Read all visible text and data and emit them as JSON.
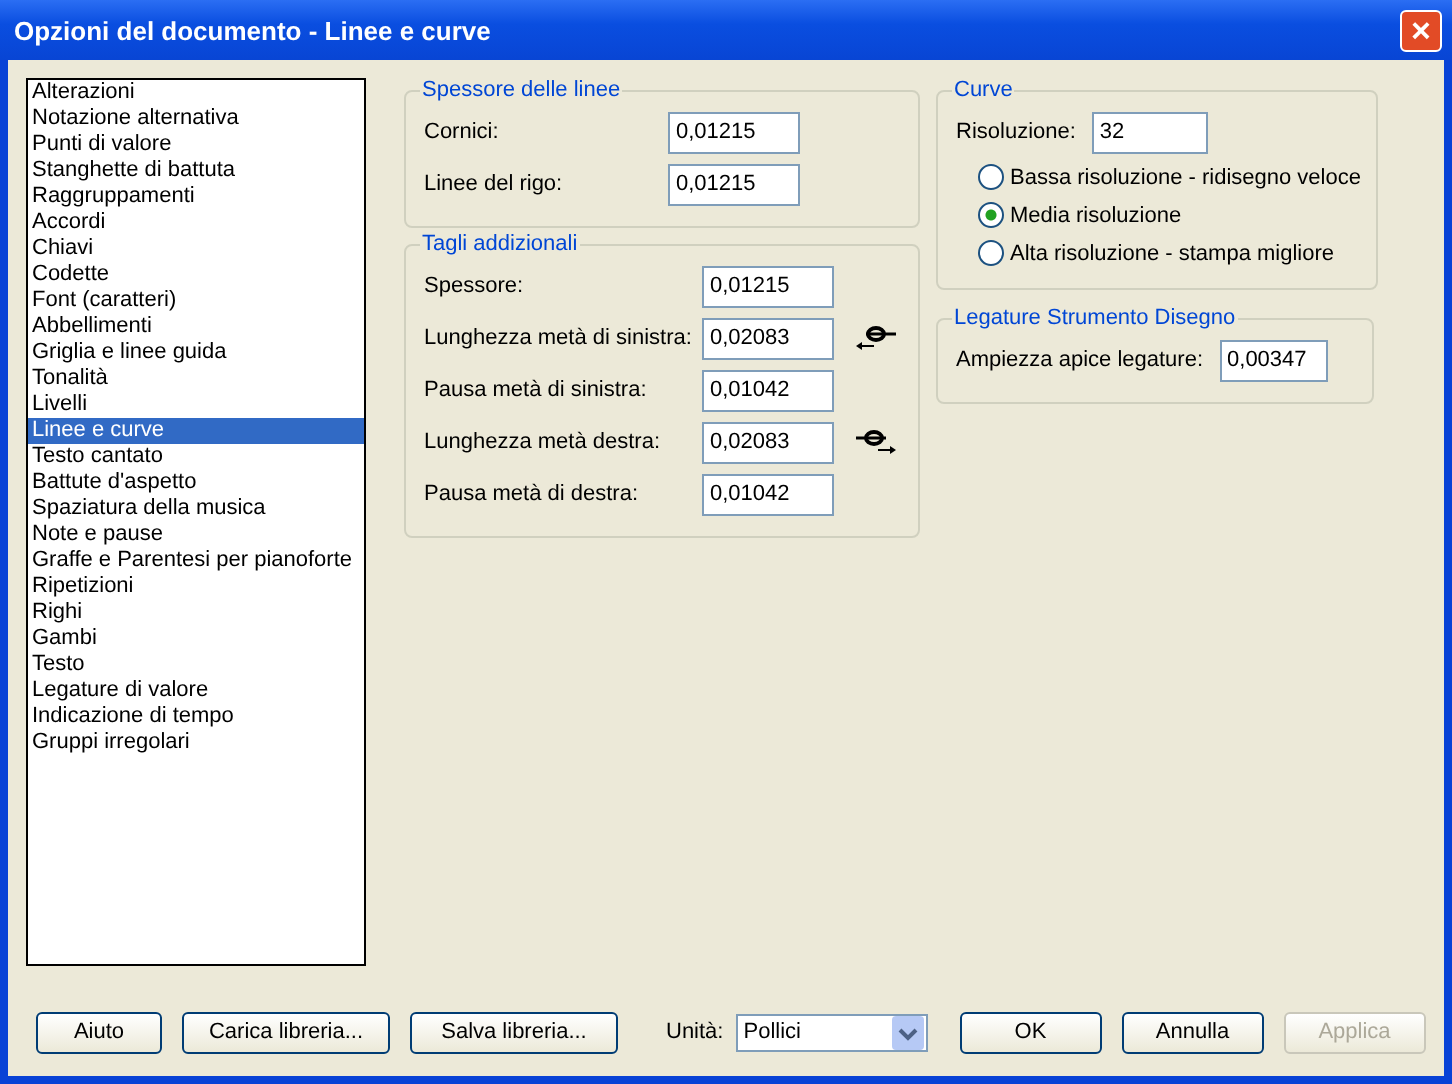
{
  "window": {
    "title": "Opzioni del documento - Linee e curve",
    "close": "×"
  },
  "sidebar": {
    "items": [
      {
        "label": "Alterazioni",
        "selected": false
      },
      {
        "label": "Notazione alternativa",
        "selected": false
      },
      {
        "label": "Punti di valore",
        "selected": false
      },
      {
        "label": "Stanghette di battuta",
        "selected": false
      },
      {
        "label": "Raggruppamenti",
        "selected": false
      },
      {
        "label": "Accordi",
        "selected": false
      },
      {
        "label": "Chiavi",
        "selected": false
      },
      {
        "label": "Codette",
        "selected": false
      },
      {
        "label": "Font (caratteri)",
        "selected": false
      },
      {
        "label": "Abbellimenti",
        "selected": false
      },
      {
        "label": "Griglia e linee guida",
        "selected": false
      },
      {
        "label": "Tonalità",
        "selected": false
      },
      {
        "label": "Livelli",
        "selected": false
      },
      {
        "label": "Linee e curve",
        "selected": true
      },
      {
        "label": "Testo cantato",
        "selected": false
      },
      {
        "label": "Battute d'aspetto",
        "selected": false
      },
      {
        "label": "Spaziatura della musica",
        "selected": false
      },
      {
        "label": "Note e pause",
        "selected": false
      },
      {
        "label": "Graffe e Parentesi per pianoforte",
        "selected": false
      },
      {
        "label": "Ripetizioni",
        "selected": false
      },
      {
        "label": "Righi",
        "selected": false
      },
      {
        "label": "Gambi",
        "selected": false
      },
      {
        "label": "Testo",
        "selected": false
      },
      {
        "label": "Legature di valore",
        "selected": false
      },
      {
        "label": "Indicazione di tempo",
        "selected": false
      },
      {
        "label": "Gruppi irregolari",
        "selected": false
      }
    ]
  },
  "line_thickness": {
    "title": "Spessore delle linee",
    "fields": [
      {
        "label": "Cornici:",
        "value": "0,01215"
      },
      {
        "label": "Linee del rigo:",
        "value": "0,01215"
      }
    ]
  },
  "ledger_lines": {
    "title": "Tagli addizionali",
    "fields": [
      {
        "label": "Spessore:",
        "value": "0,01215",
        "kind": "plain"
      },
      {
        "label": "Lunghezza metà di sinistra:",
        "value": "0,02083",
        "kind": "left"
      },
      {
        "label": "Pausa metà di sinistra:",
        "value": "0,01042",
        "kind": "plain"
      },
      {
        "label": "Lunghezza metà destra:",
        "value": "0,02083",
        "kind": "right"
      },
      {
        "label": "Pausa metà di destra:",
        "value": "0,01042",
        "kind": "plain"
      }
    ]
  },
  "curves": {
    "title": "Curve",
    "resolution_label": "Risoluzione:",
    "resolution_value": "32",
    "options": [
      {
        "label": "Bassa risoluzione - ridisegno veloce",
        "selected": false
      },
      {
        "label": "Media risoluzione",
        "selected": true
      },
      {
        "label": "Alta risoluzione - stampa migliore",
        "selected": false
      }
    ]
  },
  "slurs": {
    "title": "Legature Strumento Disegno",
    "label": "Ampiezza apice legature:",
    "value": "0,00347"
  },
  "footer": {
    "help": "Aiuto",
    "load": "Carica libreria...",
    "save": "Salva libreria...",
    "units_label": "Unità:",
    "units_value": "Pollici",
    "ok": "OK",
    "cancel": "Annulla",
    "apply": "Applica",
    "apply_disabled": true
  }
}
